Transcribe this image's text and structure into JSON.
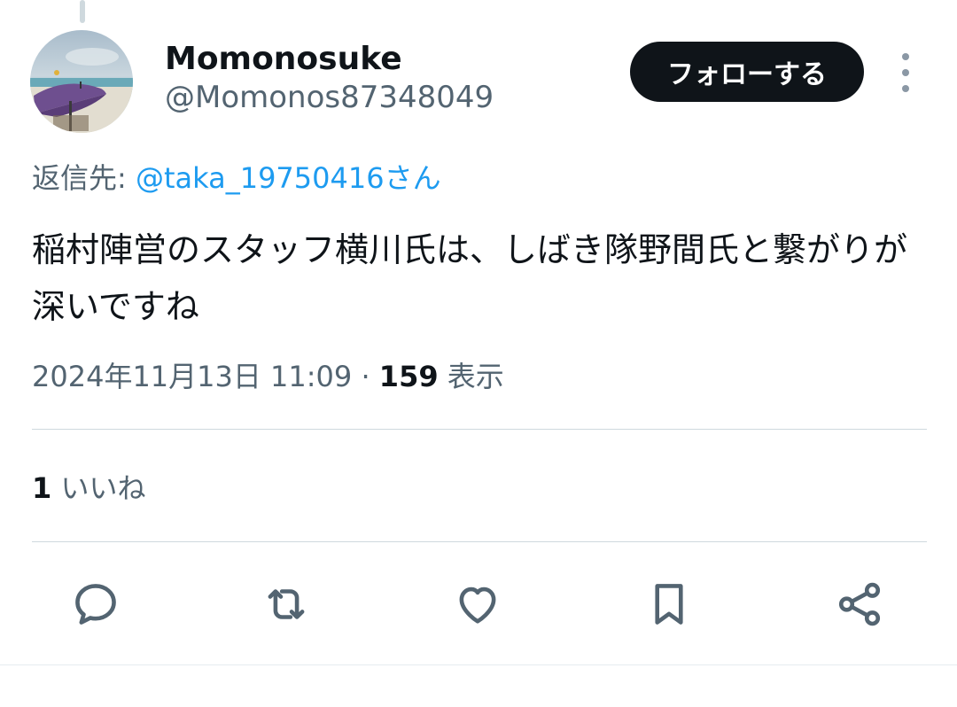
{
  "author": {
    "display_name": "Momonosuke",
    "handle": "@Momonos87348049",
    "avatar_icon": "beach-umbrella-photo"
  },
  "follow_button": {
    "label": "フォローする"
  },
  "more_button": {
    "icon": "more-vertical-icon"
  },
  "reply_context": {
    "prefix": "返信先: ",
    "target": "@taka_19750416さん"
  },
  "tweet": {
    "text": "稲村陣営のスタッフ横川氏は、しばき隊野間氏と繋がりが深いですね"
  },
  "meta": {
    "timestamp": "2024年11月13日 11:09",
    "separator": " · ",
    "views_count": "159",
    "views_label": " 表示"
  },
  "stats": {
    "likes_count": "1",
    "likes_label": " いいね"
  },
  "actions": [
    {
      "name": "reply",
      "icon": "reply-icon"
    },
    {
      "name": "retweet",
      "icon": "retweet-icon"
    },
    {
      "name": "like",
      "icon": "heart-icon"
    },
    {
      "name": "bookmark",
      "icon": "bookmark-icon"
    },
    {
      "name": "share",
      "icon": "share-icon"
    }
  ],
  "colors": {
    "text_primary": "#0f1419",
    "text_secondary": "#536471",
    "link": "#1d9bf0",
    "button_bg": "#0f1419",
    "divider": "#cfd9de"
  }
}
